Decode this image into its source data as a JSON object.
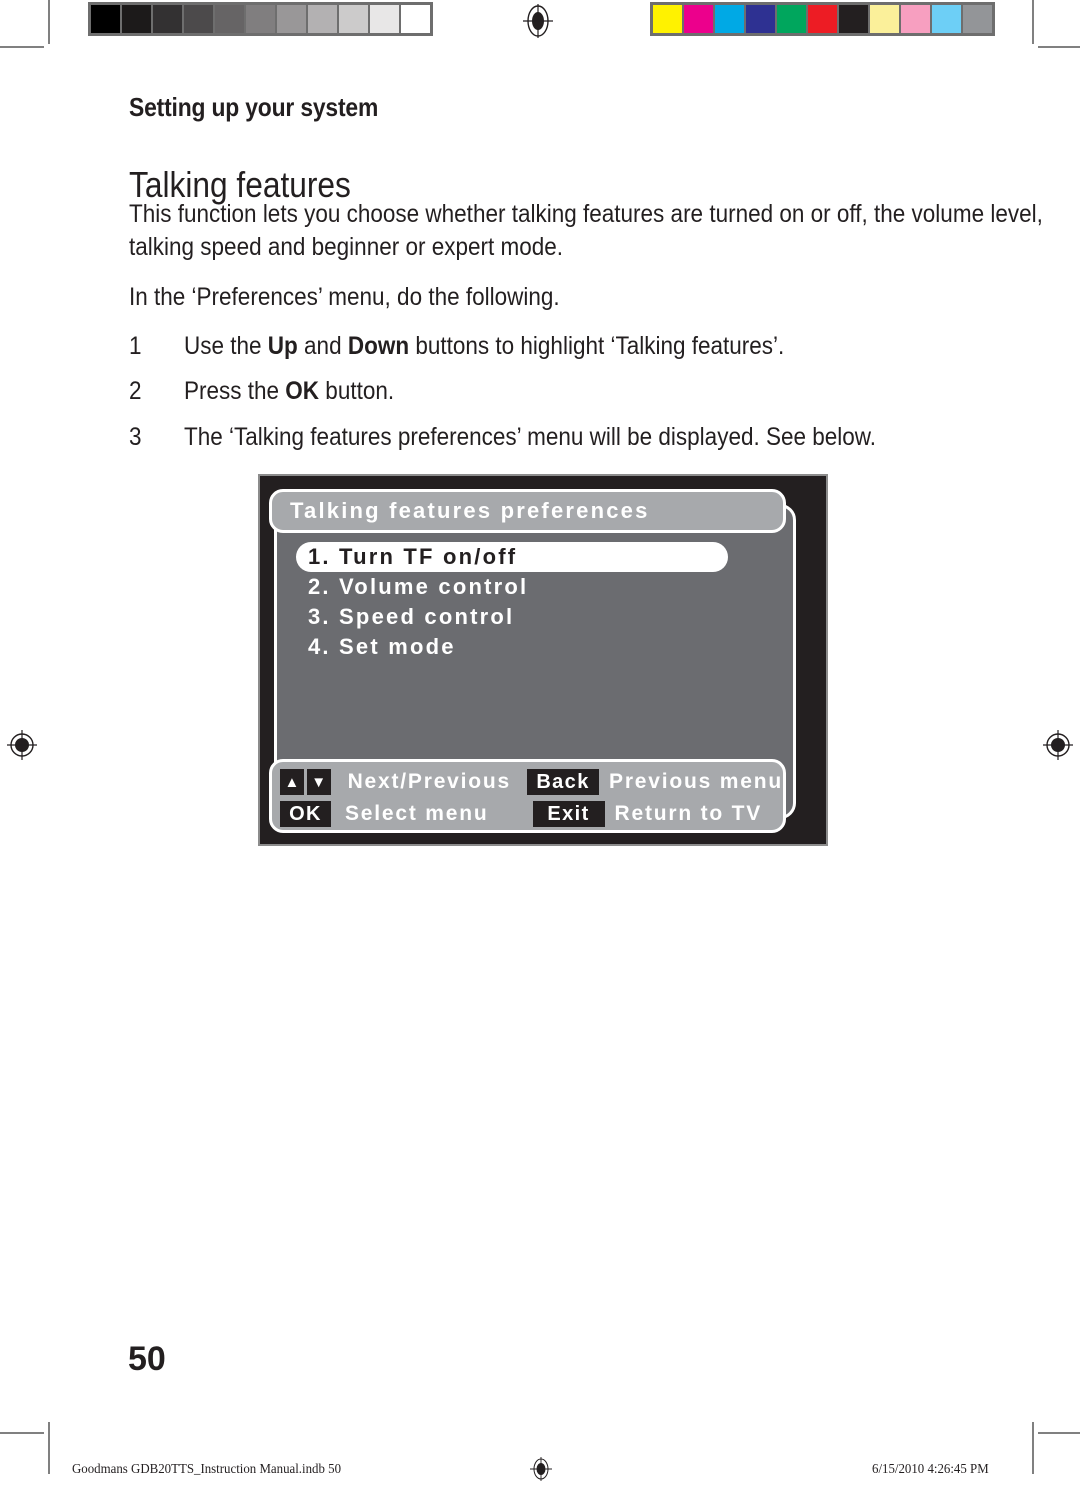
{
  "page": {
    "kicker": "Setting up your system",
    "title": "Talking features",
    "paragraph_1": "This function lets you choose whether talking features are turned on or off, the volume level, talking speed and beginner or expert mode.",
    "paragraph_2": "In the ‘Preferences’ menu, do the following.",
    "folio": "50"
  },
  "steps": [
    {
      "number": "1",
      "text_before": "Use the ",
      "bold_1": "Up",
      "text_mid": " and ",
      "bold_2": "Down",
      "text_after": " buttons to highlight ‘Talking features’."
    },
    {
      "number": "2",
      "text_before": "Press the ",
      "bold_1": "OK",
      "text_mid": "",
      "bold_2": "",
      "text_after": " button."
    },
    {
      "number": "3",
      "text_before": "The ‘Talking features preferences’ menu will be displayed. See below.",
      "bold_1": "",
      "text_mid": "",
      "bold_2": "",
      "text_after": ""
    }
  ],
  "osd": {
    "title": "Talking features preferences",
    "menu_items": [
      {
        "label": "1. Turn TF on/off",
        "selected": true
      },
      {
        "label": "2. Volume control",
        "selected": false
      },
      {
        "label": "3. Speed control",
        "selected": false
      },
      {
        "label": "4. Set mode",
        "selected": false
      }
    ],
    "hints": [
      {
        "key_up": "▲",
        "key_down": "▼",
        "label": "Next/Previous",
        "key2": "Back",
        "label2": "Previous menu"
      },
      {
        "key_up": "OK",
        "key_down": "",
        "label": "Select menu",
        "key2": "Exit",
        "label2": "Return to TV"
      }
    ],
    "colors": {
      "bezel": "#231f20",
      "panel": "#6b6c70",
      "chrome": "#a7a9ac",
      "highlight": "#ffffff",
      "key_bg": "#231f20"
    }
  },
  "footer": {
    "file": "Goodmans GDB20TTS_Instruction Manual.indb   50",
    "timestamp": "6/15/2010   4:26:45 PM"
  },
  "calibration": {
    "grayscale": [
      "#000000",
      "#1c1a1a",
      "#333132",
      "#4c4a4b",
      "#666465",
      "#807e7f",
      "#999798",
      "#b3b1b2",
      "#cccbcb",
      "#e8e7e7",
      "#ffffff"
    ],
    "colorbar": [
      "#fff200",
      "#ec008c",
      "#00a9e5",
      "#2e3192",
      "#00a65d",
      "#ed1c24",
      "#231f20",
      "#fbf09a",
      "#f79fc0",
      "#6dcff6",
      "#939598"
    ]
  }
}
